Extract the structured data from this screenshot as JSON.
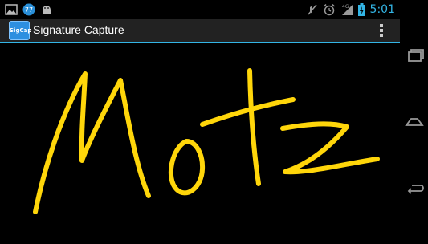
{
  "status_bar": {
    "time": "5:01",
    "notification_badge": "77",
    "network_type": "4G",
    "icons": [
      "image-icon",
      "notification-count-icon",
      "android-icon",
      "mute-icon",
      "alarm-icon",
      "signal-icon",
      "battery-charging-icon"
    ]
  },
  "action_bar": {
    "app_icon_text": "SigCap",
    "title": "Signature Capture",
    "accent_color": "#33b5e5"
  },
  "signature": {
    "ink_color": "#ffd60a",
    "background_color": "#000000",
    "handwritten_text": "Motz"
  },
  "nav_bar": {
    "buttons": [
      "recent-apps",
      "home",
      "back"
    ]
  }
}
